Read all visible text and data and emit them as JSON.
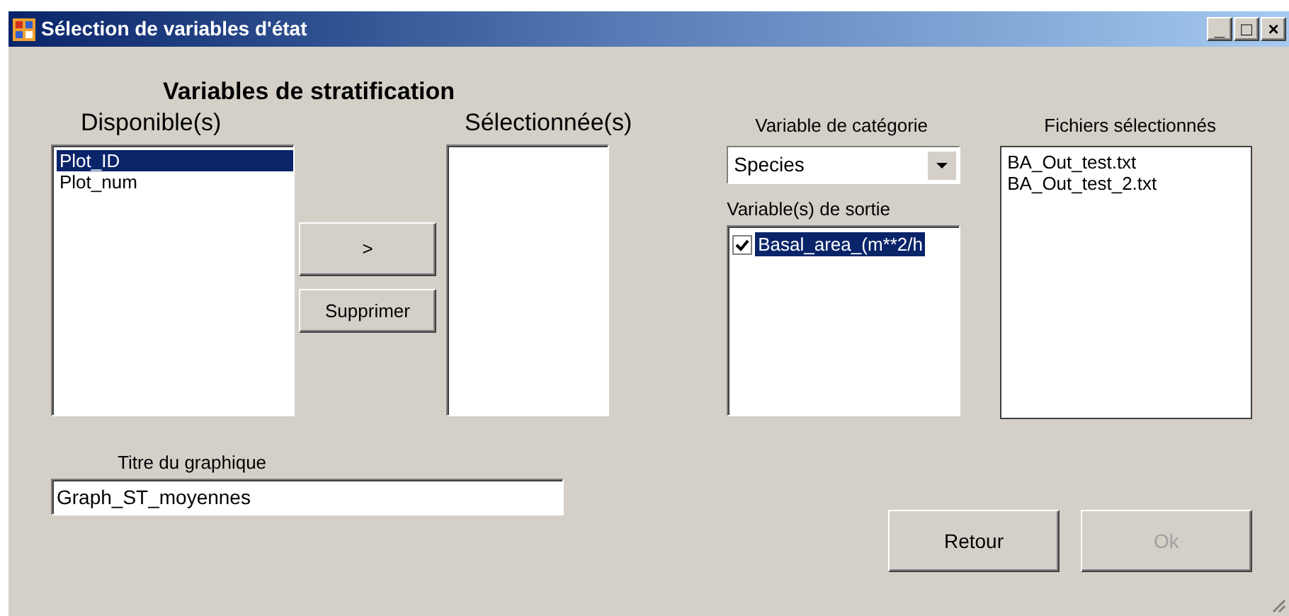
{
  "window": {
    "title": "Sélection de variables d'état",
    "controls": [
      "_",
      "□",
      "×"
    ]
  },
  "group_title": "Variables de stratification",
  "available": {
    "label": "Disponible(s)",
    "items": [
      {
        "text": "Plot_ID",
        "selected": true
      },
      {
        "text": "Plot_num",
        "selected": false
      }
    ]
  },
  "move_buttons": [
    {
      "label": ">",
      "disabled": false
    },
    {
      "label": "Supprimer",
      "disabled": false
    }
  ],
  "selected_list": {
    "label": "Sélectionnée(s)"
  },
  "category": {
    "label": "Variable de catégorie",
    "value": "Species"
  },
  "outputs": {
    "label": "Variable(s) de sortie",
    "items": [
      {
        "text": "Basal_area_(m**2/h",
        "checked": true,
        "selected": true
      }
    ]
  },
  "files": {
    "label": "Fichiers sélectionnés",
    "items": [
      {
        "text": "BA_Out_test.txt",
        "selected": false
      },
      {
        "text": "BA_Out_test_2.txt",
        "selected": false
      }
    ]
  },
  "chart_title": {
    "label": "Titre du graphique",
    "value": "Graph_ST_moyennes"
  },
  "buttons": [
    {
      "label": "Retour",
      "disabled": false
    },
    {
      "label": "Ok",
      "disabled": true
    }
  ]
}
